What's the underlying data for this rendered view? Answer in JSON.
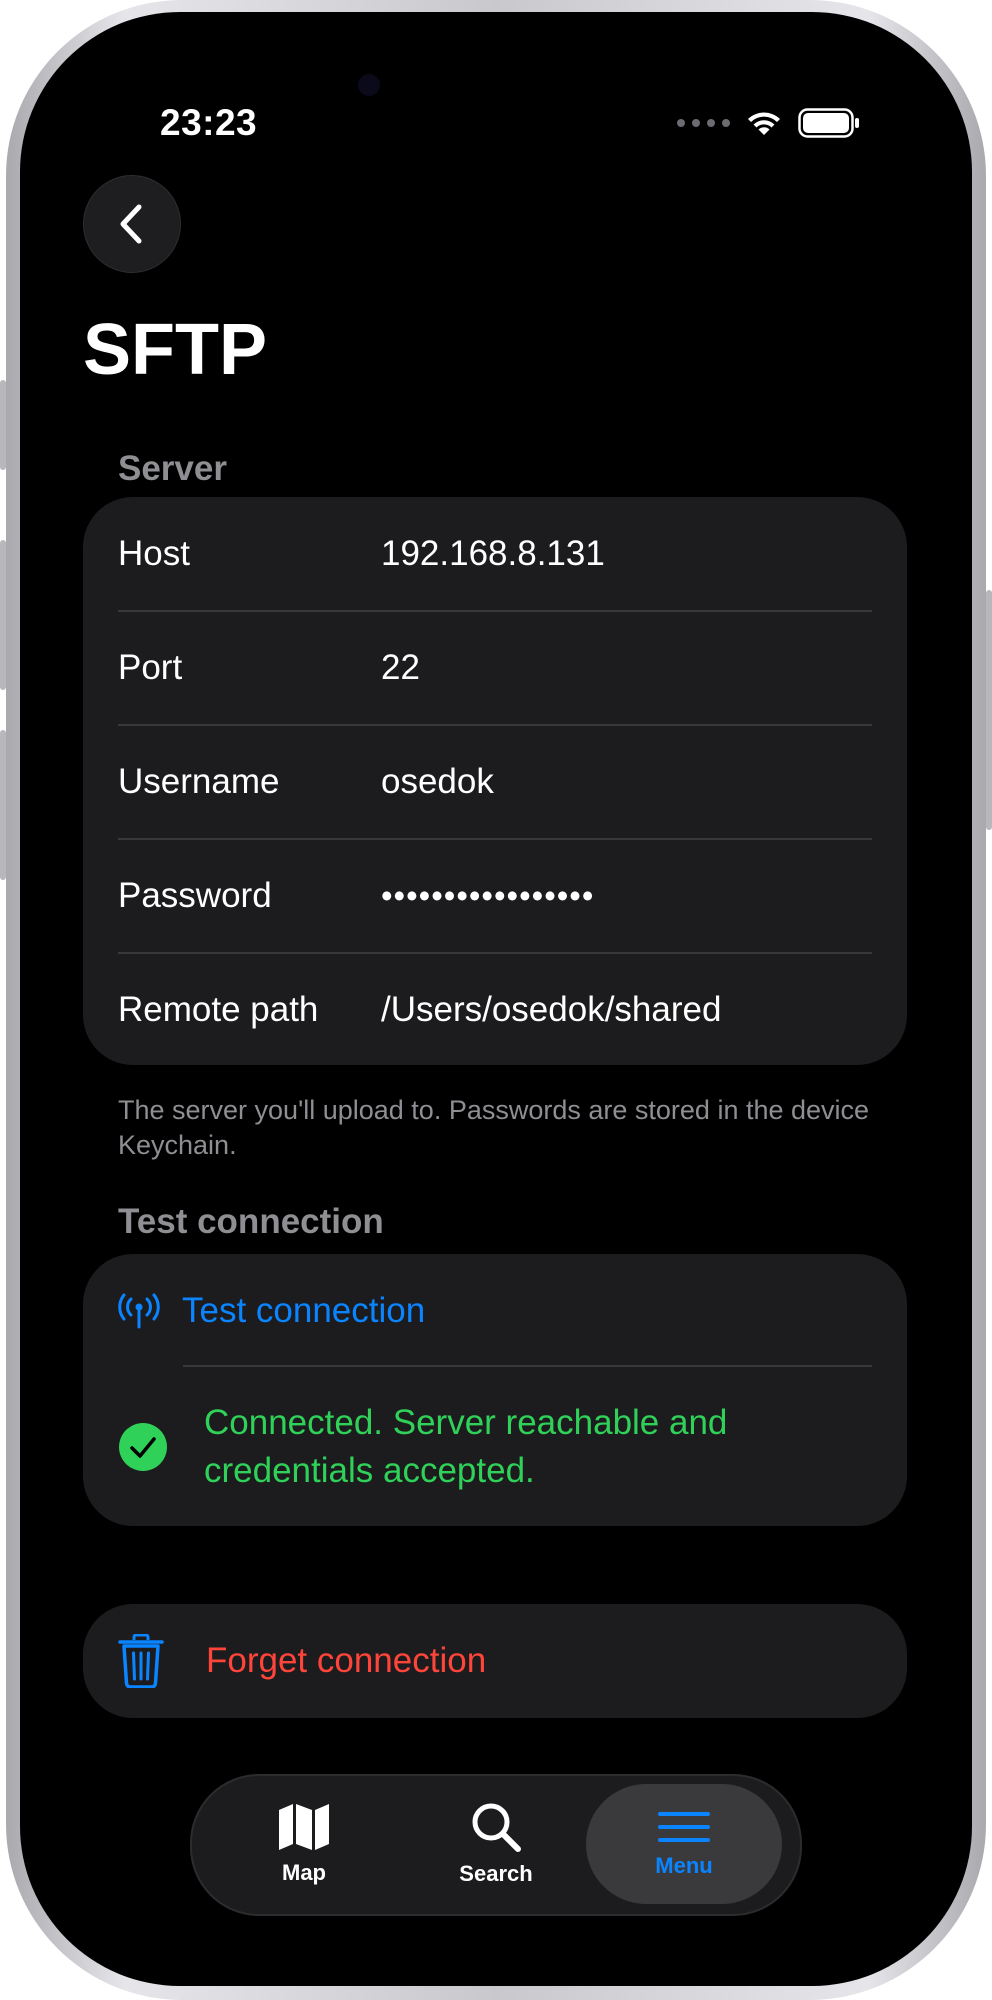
{
  "status_bar": {
    "time": "23:23"
  },
  "page": {
    "title": "SFTP"
  },
  "server_section": {
    "header": "Server",
    "rows": [
      {
        "label": "Host",
        "value": "192.168.8.131"
      },
      {
        "label": "Port",
        "value": "22"
      },
      {
        "label": "Username",
        "value": "osedok"
      },
      {
        "label": "Password",
        "value": "•••••••••••••••••"
      },
      {
        "label": "Remote path",
        "value": "/Users/osedok/shared"
      }
    ],
    "footer": "The server you'll upload to. Passwords are stored in the device Keychain."
  },
  "test_section": {
    "header": "Test connection",
    "button_label": "Test connection",
    "status_message": "Connected. Server reachable and credentials accepted.",
    "status_color": "#30d158"
  },
  "forget": {
    "label": "Forget connection",
    "color": "#ff453a"
  },
  "tabbar": {
    "tabs": [
      {
        "label": "Map",
        "icon": "map-icon",
        "active": false
      },
      {
        "label": "Search",
        "icon": "search-icon",
        "active": false
      },
      {
        "label": "Menu",
        "icon": "menu-icon",
        "active": true
      }
    ]
  },
  "colors": {
    "accent": "#0a84ff",
    "background": "#000000",
    "card": "#1c1c1e"
  }
}
